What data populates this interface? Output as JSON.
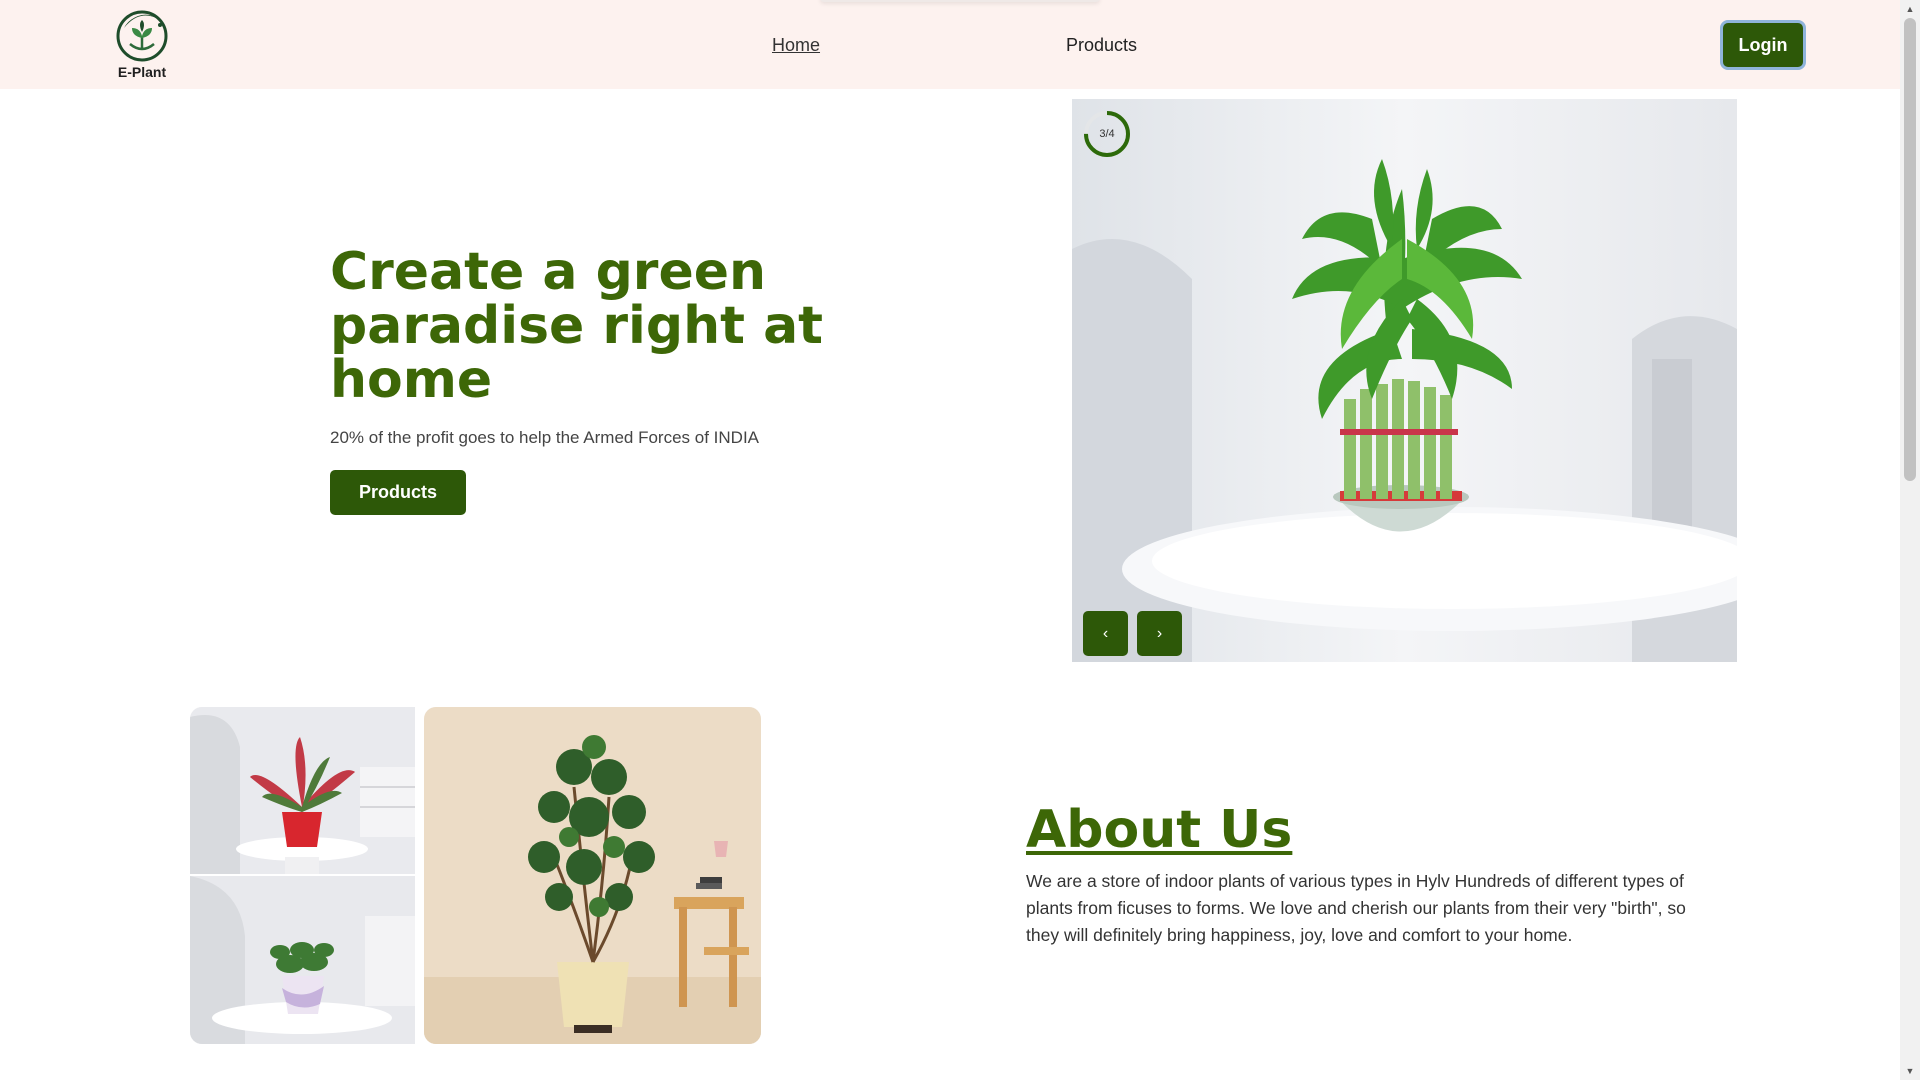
{
  "nav": {
    "logo_text": "E-Plant",
    "links": [
      {
        "label": "Home"
      },
      {
        "label": "Products"
      }
    ],
    "login_label": "Login"
  },
  "hero": {
    "title": "Create a green paradise right at home",
    "subtitle": "20% of the profit goes to help the Armed Forces of INDIA",
    "button_label": "Products"
  },
  "carousel": {
    "counter": "3/4",
    "progress": 0.75,
    "prev_label": "‹",
    "next_label": "›"
  },
  "about": {
    "title": "About Us",
    "text": "We are a store of indoor plants of various types in Hylv Hundreds of different types of plants from ficuses to forms. We love and cherish our plants from their very \"birth\", so they will definitely bring happiness, joy, love and comfort to your home."
  },
  "colors": {
    "brand_green": "#2d5808",
    "heading_green": "#3d6707",
    "nav_bg": "#fdf2ef"
  },
  "icons": {
    "logo": "plant-logo-icon",
    "prev": "chevron-left-icon",
    "next": "chevron-right-icon"
  }
}
